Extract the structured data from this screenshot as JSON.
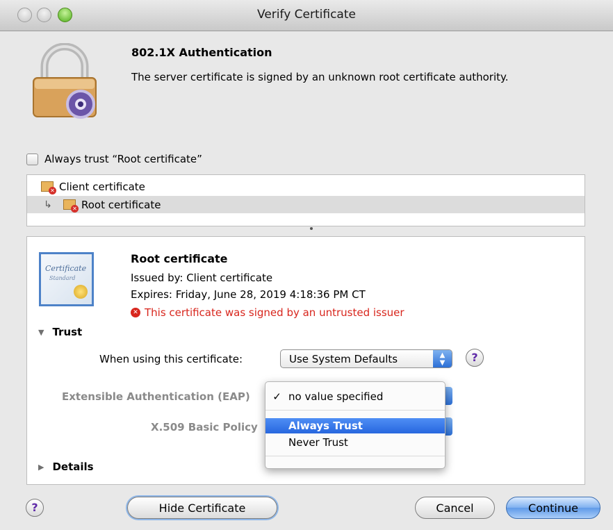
{
  "window": {
    "title": "Verify Certificate"
  },
  "header": {
    "heading": "802.1X Authentication",
    "message": "The server certificate is signed by an unknown root certificate authority."
  },
  "always_trust": {
    "label": "Always trust “Root certificate”",
    "checked": false
  },
  "chain": {
    "items": [
      {
        "label": "Client certificate",
        "selected": false
      },
      {
        "label": "Root certificate",
        "selected": true
      }
    ]
  },
  "certificate": {
    "title": "Root certificate",
    "issued_by": "Issued by: Client certificate",
    "expires": "Expires: Friday, June 28, 2019 4:18:36 PM CT",
    "warning": "This certificate was signed by an untrusted issuer",
    "image_text_1": "Certificate",
    "image_text_2": "Standard"
  },
  "trust": {
    "section_label": "Trust",
    "when_using_label": "When using this certificate:",
    "when_using_value": "Use System Defaults",
    "eap_label": "Extensible Authentication (EAP)",
    "x509_label": "X.509 Basic Policy",
    "help": "?"
  },
  "details": {
    "section_label": "Details"
  },
  "menu": {
    "items": [
      {
        "label": "no value specified",
        "checked": true,
        "check": "✓"
      },
      {
        "label": "Always Trust",
        "highlighted": true
      },
      {
        "label": "Never Trust"
      }
    ]
  },
  "buttons": {
    "help": "?",
    "hide_certificate": "Hide Certificate",
    "cancel": "Cancel",
    "continue": "Continue"
  },
  "colors": {
    "warning": "#d8261d",
    "selection": "#2767df",
    "default_button": "#5f9ae8"
  }
}
